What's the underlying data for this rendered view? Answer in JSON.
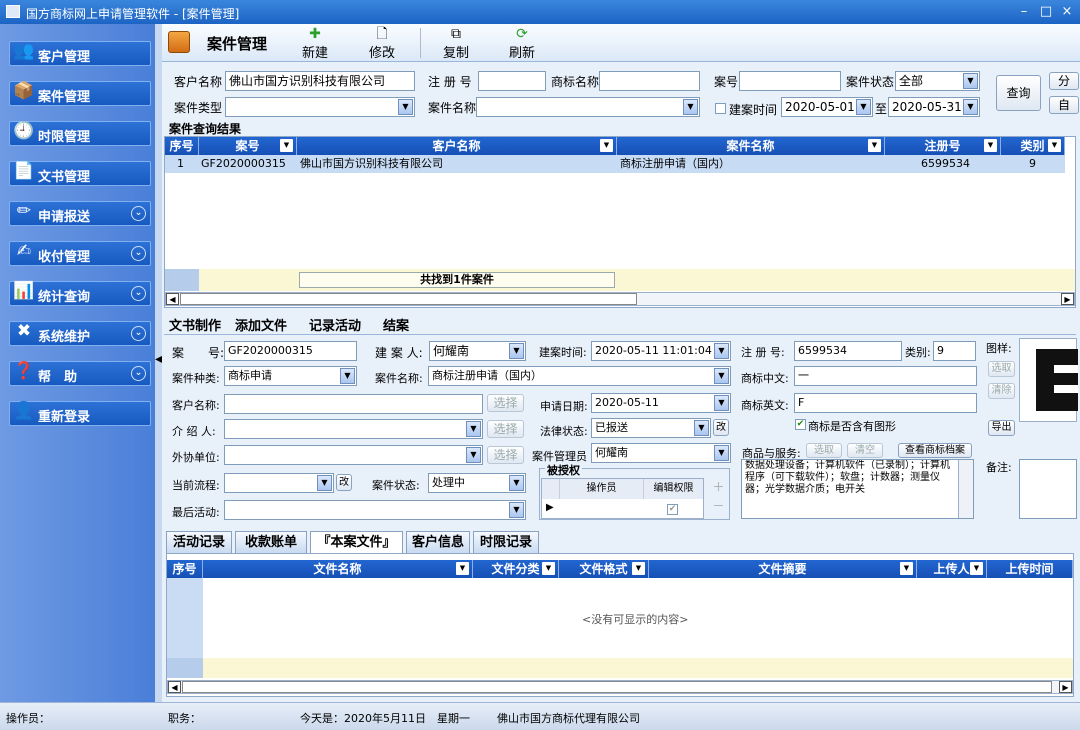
{
  "window": {
    "title": "国方商标网上申请管理软件 - [案件管理]",
    "min": "–",
    "max": "□",
    "close": "×"
  },
  "sidebar": {
    "items": [
      {
        "label": "客户管理",
        "icon": "👥"
      },
      {
        "label": "案件管理",
        "icon": "📦"
      },
      {
        "label": "时限管理",
        "icon": "🕘"
      },
      {
        "label": "文书管理",
        "icon": "📄"
      },
      {
        "label": "申请报送",
        "icon": "✏",
        "chev": "⌄"
      },
      {
        "label": "收付管理",
        "icon": "✍",
        "chev": "⌄"
      },
      {
        "label": "统计查询",
        "icon": "📊",
        "chev": "⌄"
      },
      {
        "label": "系统维护",
        "icon": "✖",
        "chev": "⌄"
      },
      {
        "label": "帮　助",
        "icon": "❓",
        "chev": "⌄"
      },
      {
        "label": "重新登录",
        "icon": "👤"
      }
    ]
  },
  "toolbar": {
    "title": "案件管理",
    "new": "新建",
    "edit": "修改",
    "copy": "复制",
    "refresh": "刷新"
  },
  "filter": {
    "client_label": "客户名称",
    "client_value": "佛山市国方识别科技有限公司",
    "reg_label": "注 册 号",
    "reg_value": "",
    "tm_label": "商标名称",
    "tm_value": "",
    "case_no_label": "案号",
    "case_no_value": "",
    "status_label": "案件状态",
    "status_value": "全部",
    "type_label": "案件类型",
    "type_value": "",
    "name_label": "案件名称",
    "name_value": "",
    "date_label": "建案时间",
    "date_from": "2020-05-01",
    "to": "至",
    "date_to": "2020-05-31",
    "query": "查询",
    "btn_a": "分",
    "btn_b": "自"
  },
  "results": {
    "group_title": "案件查询结果",
    "columns": [
      "序号",
      "案号",
      "客户名称",
      "案件名称",
      "注册号",
      "类别"
    ],
    "rows": [
      [
        "1",
        "GF2020000315",
        "佛山市国方识别科技有限公司",
        "商标注册申请（国内）",
        "6599534",
        "9"
      ]
    ],
    "footer": "共找到1件案件"
  },
  "detail_tabs": [
    "文书制作",
    "添加文件",
    "记录活动",
    "结案"
  ],
  "detail": {
    "case_no_label": "案　　号:",
    "case_no": "GF2020000315",
    "creator_label": "建 案 人:",
    "creator": "何耀南",
    "created_label": "建案时间:",
    "created": "2020-05-11 11:01:04",
    "reg_label": "注 册 号:",
    "reg": "6599534",
    "class_label": "类别:",
    "class": "9",
    "image_label": "图样:",
    "pick": "选取",
    "clear": "清除",
    "export": "导出",
    "kind_label": "案件种类:",
    "kind": "商标申请",
    "name_label": "案件名称:",
    "name": "商标注册申请（国内）",
    "cn_label": "商标中文:",
    "cn": "一",
    "client_label": "客户名称:",
    "client": "",
    "select": "选择",
    "apply_label": "申请日期:",
    "apply": "2020-05-11",
    "en_label": "商标英文:",
    "en": "F",
    "intro_label": "介 绍 人:",
    "intro": "",
    "legal_label": "法律状态:",
    "legal": "已报送",
    "legal_edit": "改",
    "has_image": "商标是否含有图形",
    "assist_label": "外协单位:",
    "assist": "",
    "manager_label": "案件管理员",
    "manager": "何耀南",
    "goods_label": "商品与服务:",
    "goods_pick": "选取",
    "goods_clear": "清空",
    "goods_view": "查看商标档案",
    "goods_text": "数据处理设备；计算机软件（已录制）；计算机程序（可下载软件）；软盘；计数器；测量仪器；光学数据介质；电开关",
    "remark_label": "备注:",
    "flow_label": "当前流程:",
    "flow": "",
    "flow_edit": "改",
    "state_label": "案件状态:",
    "state": "处理中",
    "last_label": "最后活动:",
    "last": "",
    "auth_title": "被授权",
    "auth_col1": "操作员",
    "auth_col2": "编辑权限"
  },
  "bottom_tabs": [
    "活动记录",
    "收款账单",
    "『本案文件』",
    "客户信息",
    "时限记录"
  ],
  "files": {
    "columns": [
      "序号",
      "文件名称",
      "文件分类",
      "文件格式",
      "文件摘要",
      "上传人",
      "上传时间"
    ],
    "empty": "<没有可显示的内容>"
  },
  "status": {
    "operator": "操作员：",
    "role": "职务：",
    "today": "今天是：2020年5月11日　星期一",
    "company": "佛山市国方商标代理有限公司"
  }
}
